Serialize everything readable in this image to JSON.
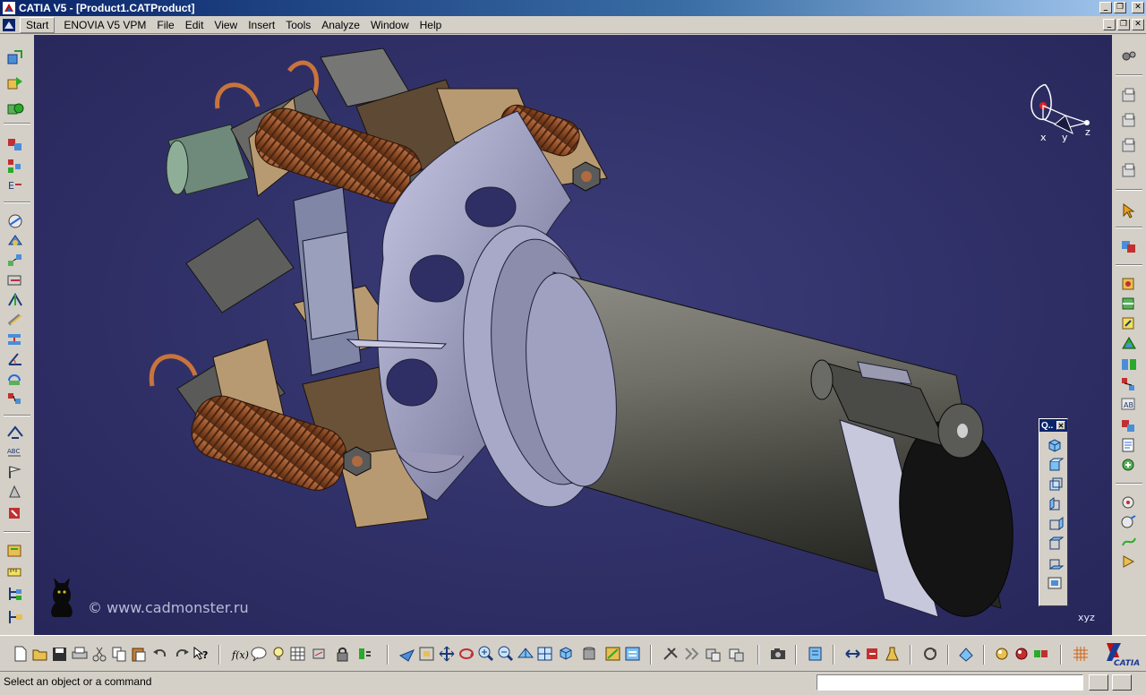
{
  "window": {
    "title": "CATIA V5 - [Product1.CATProduct]",
    "controls": {
      "minimize": "_",
      "restore": "❐",
      "close": "✕"
    }
  },
  "menubar": {
    "items": [
      "Start",
      "ENOVIA V5 VPM",
      "File",
      "Edit",
      "View",
      "Insert",
      "Tools",
      "Analyze",
      "Window",
      "Help"
    ]
  },
  "viewport": {
    "watermark": "© www.cadmonster.ru",
    "compass_axes": {
      "x": "x",
      "y": "y",
      "z": "z"
    },
    "axis_label": "xyz"
  },
  "quick_view": {
    "title": "Q..",
    "close": "✕"
  },
  "status": {
    "message": "Select an object or a command",
    "command_value": ""
  },
  "colors": {
    "viewport_bg": "#2f2f66",
    "title_bar": "#0a246a",
    "chrome": "#d4d0c8"
  }
}
